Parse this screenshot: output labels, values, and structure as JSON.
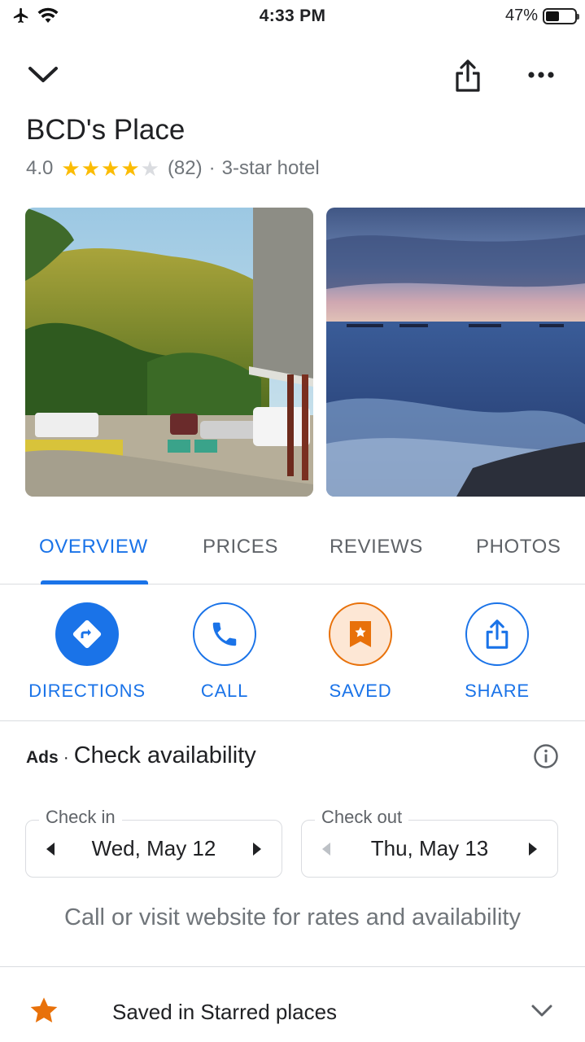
{
  "status_bar": {
    "time": "4:33 PM",
    "battery_text": "47%",
    "battery_level": 0.47
  },
  "place": {
    "name": "BCD's Place",
    "rating": "4.0",
    "stars_filled": 4,
    "stars_total": 5,
    "review_count": "(82)",
    "separator": "·",
    "category": "3-star hotel"
  },
  "tabs": [
    {
      "label": "OVERVIEW",
      "active": true
    },
    {
      "label": "PRICES",
      "active": false
    },
    {
      "label": "REVIEWS",
      "active": false
    },
    {
      "label": "PHOTOS",
      "active": false
    }
  ],
  "actions": [
    {
      "label": "DIRECTIONS",
      "icon": "directions-icon"
    },
    {
      "label": "CALL",
      "icon": "phone-icon"
    },
    {
      "label": "SAVED",
      "icon": "saved-bookmark-icon"
    },
    {
      "label": "SHARE",
      "icon": "share-icon"
    }
  ],
  "availability": {
    "ads_label": "Ads",
    "dot": "·",
    "title": "Check availability",
    "check_in": {
      "caption": "Check in",
      "value": "Wed, May 12"
    },
    "check_out": {
      "caption": "Check out",
      "value": "Thu, May 13"
    },
    "notice": "Call or visit website for rates and availability"
  },
  "saved_list": {
    "text": "Saved in Starred places"
  },
  "colors": {
    "accent_blue": "#1a73e8",
    "star_yellow": "#fbbc04",
    "saved_orange": "#e8710a"
  }
}
